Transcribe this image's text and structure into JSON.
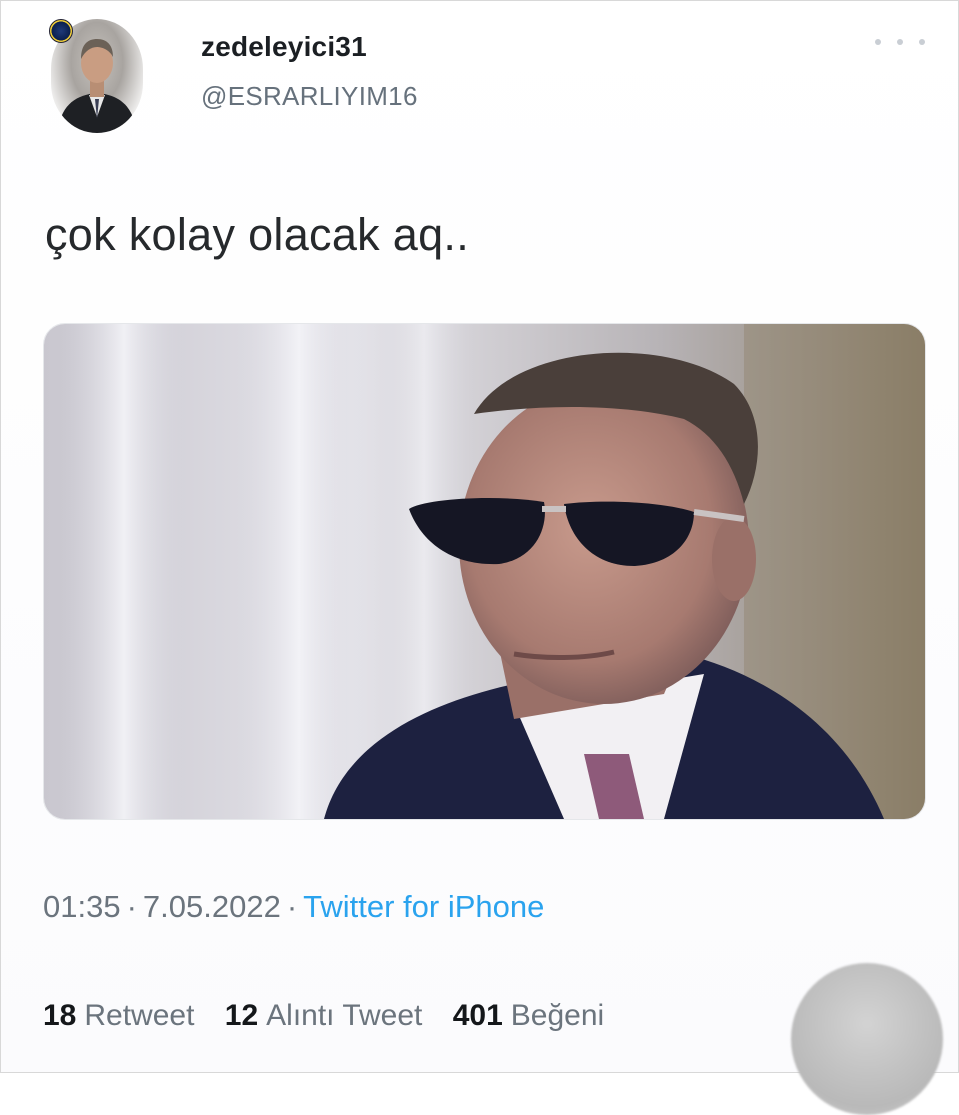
{
  "tweet": {
    "display_name": "zedeleyici31",
    "handle": "@ESRARLIYIM16",
    "text": "çok kolay olacak aq..",
    "time": "01:35",
    "date": "7.05.2022",
    "separator": "·",
    "source": "Twitter for iPhone",
    "stats": [
      {
        "count": "18",
        "label": "Retweet"
      },
      {
        "count": "12",
        "label": "Alıntı Tweet"
      },
      {
        "count": "401",
        "label": "Beğeni"
      }
    ]
  },
  "icons": {
    "more": "more-horizontal-icon",
    "badge": "club-badge-icon"
  },
  "colors": {
    "link": "#2aa3ee",
    "secondary_text": "#6b747d",
    "primary_text": "#14171a"
  }
}
